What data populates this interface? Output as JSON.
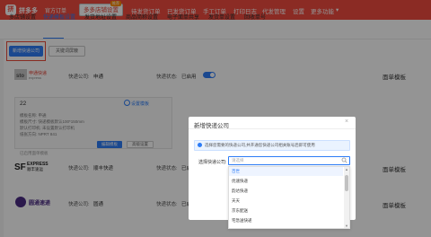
{
  "topbar": {
    "brand": "拼多多",
    "logo_text": "拼",
    "official": "官方订单",
    "nav": [
      "多多店铺设置",
      "待发货订单",
      "已发货订单",
      "手工订单",
      "打印日志",
      "代发管理",
      "设置",
      "更多功能"
    ],
    "hot_badge": "推荐",
    "user_caret": "▾"
  },
  "subtabs": [
    "多店铺设置",
    "快递模板设置",
    "发货地址设置",
    "商品简称设置",
    "电子面单共享",
    "发货单设置",
    "回收单号"
  ],
  "buttons": {
    "add_carrier": "新增快递公司",
    "shortcut_settings": "关键词屏蔽"
  },
  "carriers": [
    {
      "logo_text": "STO 申通快递",
      "logo_sub": "express",
      "label": "快递公司:",
      "name": "申通",
      "status_label": "快递状态:",
      "enabled": "已启用",
      "side_title": "面单模板"
    },
    {
      "logo_text": "SF EXPRESS 顺丰速运",
      "logo_sub": "",
      "label": "快递公司:",
      "name": "顺丰快递",
      "status_label": "快递状态:",
      "enabled": "已启用",
      "side_title": "面单模板"
    },
    {
      "logo_text": "圆通速递",
      "logo_sub": "",
      "label": "快递公司:",
      "name": "圆通",
      "status_label": "快递状态:",
      "enabled": "已启用",
      "side_title": "面单模板"
    }
  ],
  "template_card": {
    "number": "22",
    "lines": [
      "模板名称: 申通",
      "模板尺寸: 快递模板默认100*150mm",
      "默认打印机: 未设置默认打印机",
      "纸张方向: NPRT 841"
    ],
    "link": "设置模板",
    "edit": "编辑模板",
    "settings": "高级设置",
    "hint": "已启用面单模板"
  },
  "modal": {
    "title": "新增快递公司",
    "close": "×",
    "info": "选择您需要的快递公司,并开通您快递公司相关账号后即可使用",
    "select_label": "选择快递公司:",
    "placeholder": "请选择"
  },
  "dropdown": {
    "items": [
      "百世",
      "优速快递",
      "韵达快递",
      "天天",
      "京东配送",
      "宅急送快递"
    ]
  },
  "colors": {
    "brand_red": "#f04a3e",
    "accent_blue": "#2d7cf6"
  }
}
